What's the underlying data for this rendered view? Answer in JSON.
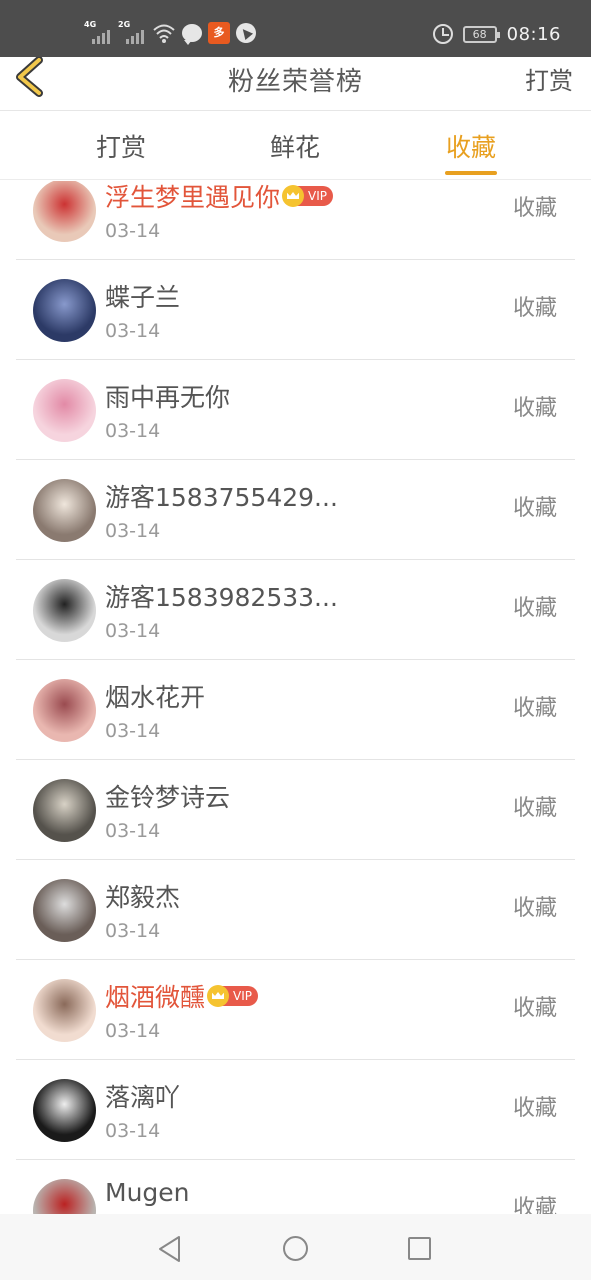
{
  "status_bar": {
    "sim1_label": "4G",
    "sim2_label": "2G",
    "app_icon_label": "多",
    "battery_level": "68",
    "time": "08:16"
  },
  "header": {
    "title": "粉丝荣誉榜",
    "right_link": "打赏"
  },
  "tabs": [
    {
      "label": "打赏",
      "active": false
    },
    {
      "label": "鲜花",
      "active": false
    },
    {
      "label": "收藏",
      "active": true
    }
  ],
  "vip_badge_text": "VIP",
  "colors": {
    "accent": "#e8a020",
    "vip_name": "#e2553a",
    "status_bar": "#4d4d4d"
  },
  "fans": [
    {
      "name": "浮生梦里遇见你",
      "vip": true,
      "date": "03-14",
      "action": "收藏",
      "avatar_glyph": "",
      "avatar_bg": "#e9c9b8",
      "avatar_fg": "#c33"
    },
    {
      "name": "蝶子兰",
      "vip": false,
      "date": "03-14",
      "action": "收藏",
      "avatar_glyph": "",
      "avatar_bg": "#2c3a66",
      "avatar_fg": "#8899cc"
    },
    {
      "name": "雨中再无你",
      "vip": false,
      "date": "03-14",
      "action": "收藏",
      "avatar_glyph": "",
      "avatar_bg": "#f6d4de",
      "avatar_fg": "#e28aa6"
    },
    {
      "name": "游客1583755429...",
      "vip": false,
      "date": "03-14",
      "action": "收藏",
      "avatar_glyph": "",
      "avatar_bg": "#8a7a70",
      "avatar_fg": "#efe6dc"
    },
    {
      "name": "游客1583982533...",
      "vip": false,
      "date": "03-14",
      "action": "收藏",
      "avatar_glyph": "",
      "avatar_bg": "#d8d8d8",
      "avatar_fg": "#222"
    },
    {
      "name": "烟水花开",
      "vip": false,
      "date": "03-14",
      "action": "收藏",
      "avatar_glyph": "",
      "avatar_bg": "#e9b7b0",
      "avatar_fg": "#9a4b50"
    },
    {
      "name": "金铃梦诗云",
      "vip": false,
      "date": "03-14",
      "action": "收藏",
      "avatar_glyph": "",
      "avatar_bg": "#55524c",
      "avatar_fg": "#d8d2c6"
    },
    {
      "name": "郑毅杰",
      "vip": false,
      "date": "03-14",
      "action": "收藏",
      "avatar_glyph": "",
      "avatar_bg": "#6a5e58",
      "avatar_fg": "#ddd"
    },
    {
      "name": "烟酒微醺",
      "vip": true,
      "date": "03-14",
      "action": "收藏",
      "avatar_glyph": "",
      "avatar_bg": "#f1dcd0",
      "avatar_fg": "#8a6a5a"
    },
    {
      "name": "落漓吖",
      "vip": false,
      "date": "03-14",
      "action": "收藏",
      "avatar_glyph": "",
      "avatar_bg": "#1a1a1a",
      "avatar_fg": "#eee"
    },
    {
      "name": "Mugen",
      "vip": false,
      "date": "",
      "action": "收藏",
      "avatar_glyph": "",
      "avatar_bg": "#b9b4b0",
      "avatar_fg": "#b22"
    }
  ]
}
